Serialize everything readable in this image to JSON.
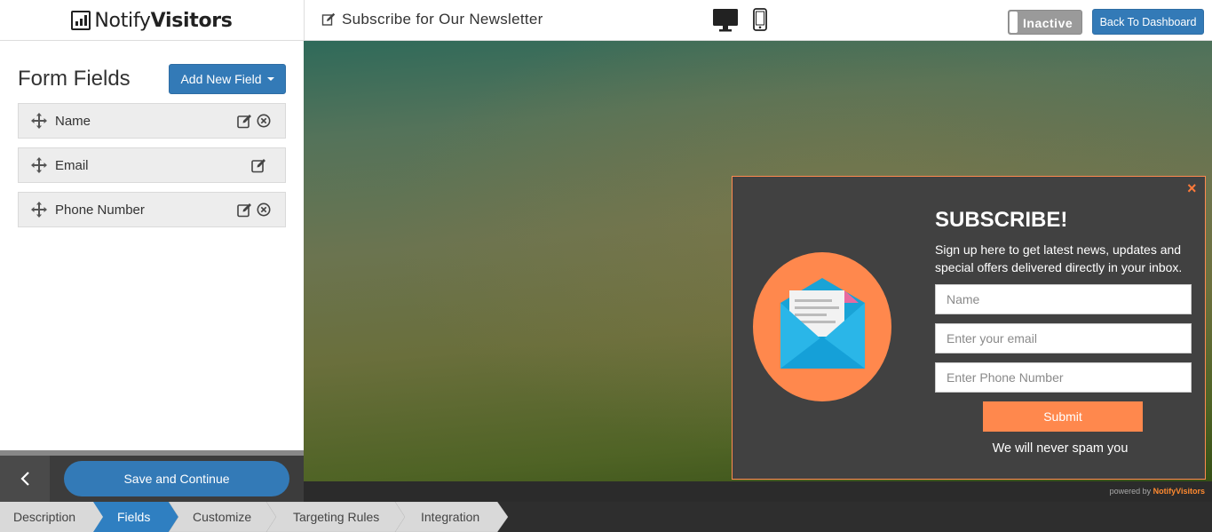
{
  "app": {
    "brand_light": "Notify",
    "brand_bold": "Visitors",
    "page_title": "Subscribe for Our Newsletter",
    "status_label": "Inactive",
    "back_button": "Back To Dashboard"
  },
  "sidebar": {
    "title": "Form Fields",
    "add_button": "Add New Field",
    "fields": [
      {
        "label": "Name",
        "removable": true
      },
      {
        "label": "Email",
        "removable": false
      },
      {
        "label": "Phone Number",
        "removable": true
      }
    ],
    "save_button": "Save and Continue"
  },
  "popup": {
    "heading": "SUBSCRIBE!",
    "description": "Sign up here to get latest news, updates and special offers delivered directly in your inbox.",
    "inputs": [
      {
        "placeholder": "Name"
      },
      {
        "placeholder": "Enter your email"
      },
      {
        "placeholder": "Enter Phone Number"
      }
    ],
    "submit": "Submit",
    "note": "We will never spam you",
    "close": "×"
  },
  "powered": {
    "prefix": "powered by",
    "brand": "NotifyVisitors"
  },
  "steps": [
    {
      "label": "Description",
      "active": false
    },
    {
      "label": "Fields",
      "active": true
    },
    {
      "label": "Customize",
      "active": false
    },
    {
      "label": "Targeting Rules",
      "active": false
    },
    {
      "label": "Integration",
      "active": false
    }
  ],
  "colors": {
    "primary": "#337ab7",
    "accent": "#ff884d",
    "inactive": "#9a9a9a",
    "step_active": "#2f7fc1",
    "step_inactive": "#d9d9d9"
  },
  "icons": {
    "move": "move-icon",
    "edit": "edit-icon",
    "delete": "remove-icon",
    "desktop": "desktop-icon",
    "mobile": "mobile-icon",
    "back": "chevron-left-icon",
    "envelope": "envelope-icon"
  }
}
